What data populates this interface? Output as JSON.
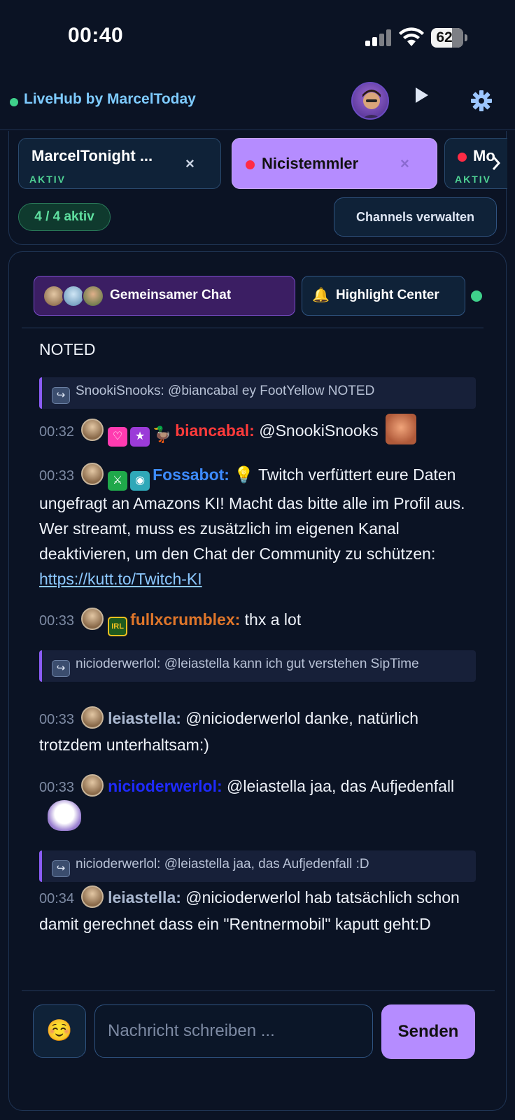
{
  "status_bar": {
    "time": "00:40",
    "battery": "62"
  },
  "header": {
    "app_title": "LiveHub by MarcelToday"
  },
  "channels": {
    "tabs": [
      {
        "name": "MarcelTonight ...",
        "status": "AKTIV",
        "close": "×",
        "selected": false
      },
      {
        "name": "Nicistemmler",
        "status": "",
        "close": "×",
        "selected": true
      },
      {
        "name": "Mo",
        "status": "AKTIV",
        "close": "",
        "selected": false
      }
    ],
    "active_count": "4 / 4 aktiv",
    "manage_label": "Channels verwalten"
  },
  "chat_tabs": {
    "shared_label": "Gemeinsamer Chat",
    "highlight_icon": "🔔",
    "highlight_label": "Highlight Center"
  },
  "messages": [
    {
      "text": "NOTED"
    },
    {
      "reply": "SnookiSnooks: @biancabal ey FootYellow NOTED"
    },
    {
      "time": "00:32",
      "user": "biancabal:",
      "color": "#ff3b3b",
      "text": "@SnookiSnooks"
    },
    {
      "time": "00:33",
      "user": "Fossabot:",
      "color": "#3d8bff",
      "text": "💡 Twitch verfüttert eure Daten ungefragt an Amazons KI! Macht das bitte alle im Profil aus. Wer streamt, muss es zusätzlich im eigenen Kanal deaktivieren, um den Chat der Community zu schützen: ",
      "link": "https://kutt.to/Twitch-KI"
    },
    {
      "time": "00:33",
      "user": "fullxcrumblex:",
      "color": "#e0762a",
      "text": "thx a lot",
      "badge": "IRL"
    },
    {
      "reply": "nicioderwerlol: @leiastella kann ich gut verstehen SipTime"
    },
    {
      "time": "00:33",
      "user": "leiastella:",
      "color": "#aab8d0",
      "text": "@nicioderwerlol danke, natürlich trotzdem unterhaltsam:)"
    },
    {
      "time": "00:33",
      "user": "nicioderwerlol:",
      "color": "#1f2bff",
      "text": "@leiastella jaa, das Aufjedenfall"
    },
    {
      "reply": "nicioderwerlol: @leiastella jaa, das Aufjedenfall :D"
    },
    {
      "time": "00:34",
      "user": "leiastella:",
      "color": "#aab8d0",
      "text": "@nicioderwerlol hab tatsächlich schon damit gerechnet dass ein \"Rentnermobil\" kaputt geht:D"
    }
  ],
  "composer": {
    "emoji": "☺️",
    "placeholder": "Nachricht schreiben ...",
    "send_label": "Senden"
  },
  "colors": {
    "accent": "#b58cff",
    "live": "#3fd18b",
    "link": "#8cc8ff"
  }
}
